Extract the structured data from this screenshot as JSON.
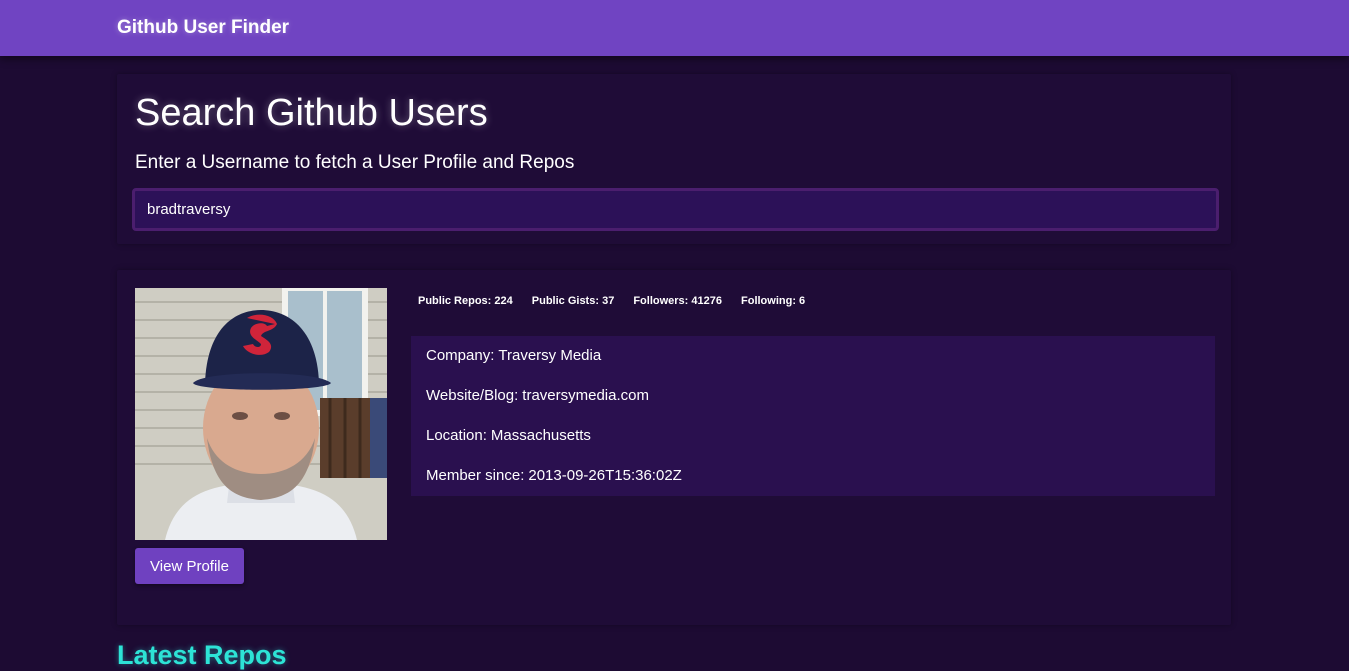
{
  "navbar": {
    "brand": "Github User Finder"
  },
  "search": {
    "title": "Search Github Users",
    "subtitle": "Enter a Username to fetch a User Profile and Repos",
    "input_value": "bradtraversy"
  },
  "profile": {
    "view_profile_label": "View Profile",
    "stats": [
      {
        "label": "Public Repos:",
        "value": "224"
      },
      {
        "label": "Public Gists:",
        "value": "37"
      },
      {
        "label": "Followers:",
        "value": "41276"
      },
      {
        "label": "Following:",
        "value": "6"
      }
    ],
    "details": [
      {
        "label": "Company:",
        "value": "Traversy Media"
      },
      {
        "label": "Website/Blog:",
        "value": "traversymedia.com"
      },
      {
        "label": "Location:",
        "value": "Massachusetts"
      },
      {
        "label": "Member since:",
        "value": "2013-09-26T15:36:02Z"
      }
    ]
  },
  "repos": {
    "heading": "Latest Repos"
  },
  "colors": {
    "navbar": "#7044c2",
    "background": "#1d0b33",
    "card": "#1f0c37",
    "details_panel": "#2a104f",
    "input": "#2c1158",
    "button": "#6f41c0",
    "accent_teal": "#2de3d6"
  }
}
